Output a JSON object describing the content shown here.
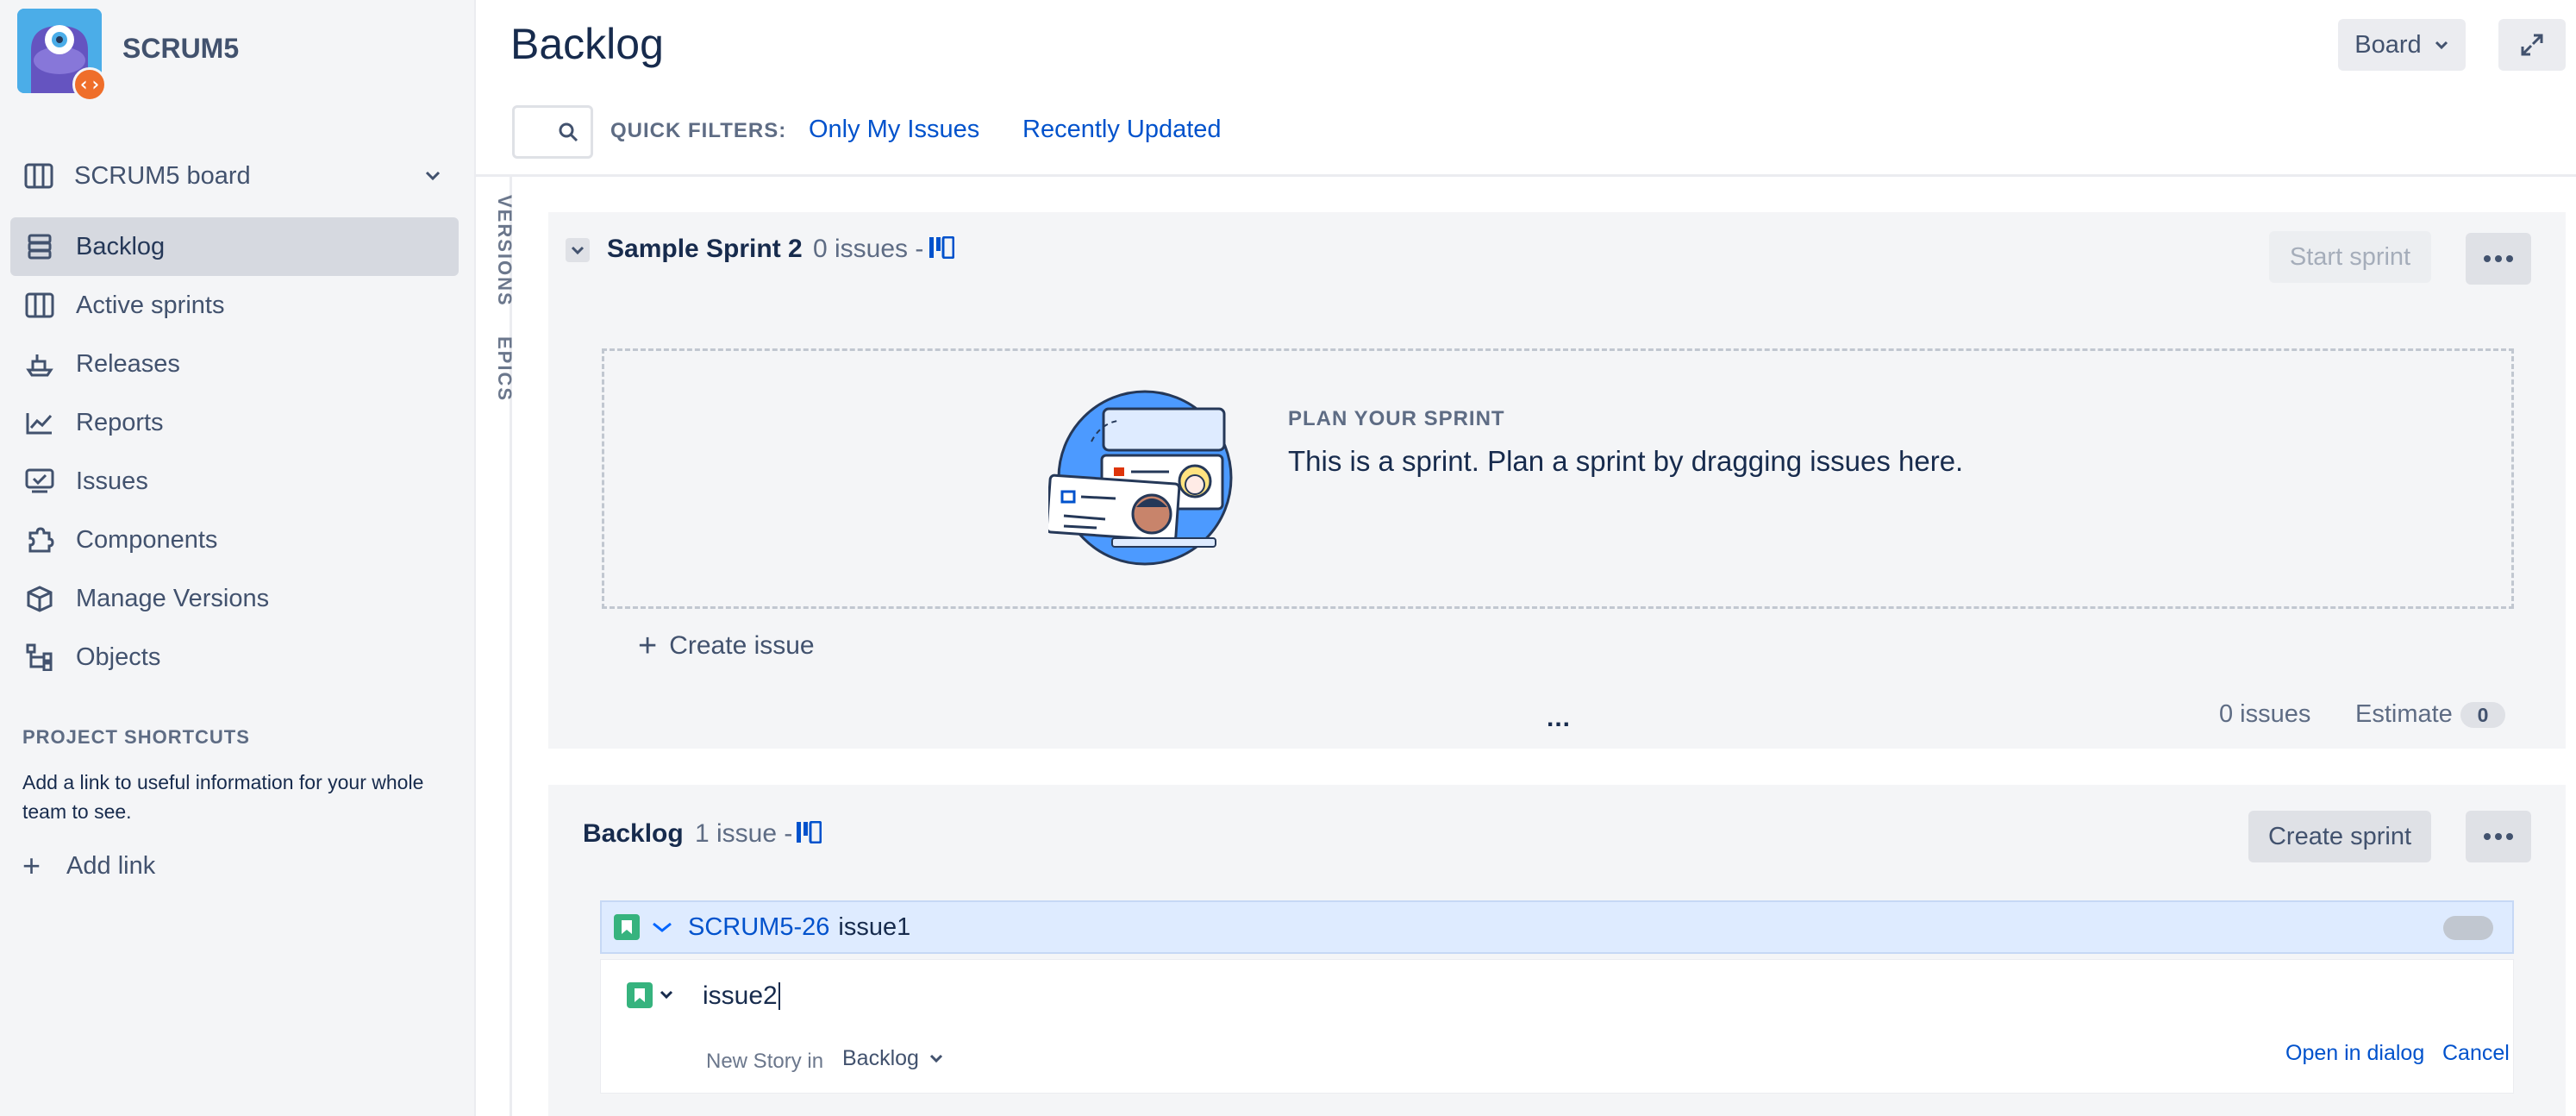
{
  "sidebar": {
    "project_name": "SCRUM5",
    "board_select_label": "SCRUM5 board",
    "nav": [
      {
        "label": "Backlog",
        "icon": "backlog-icon",
        "active": true
      },
      {
        "label": "Active sprints",
        "icon": "active-sprints-icon"
      },
      {
        "label": "Releases",
        "icon": "releases-icon"
      },
      {
        "label": "Reports",
        "icon": "reports-icon"
      },
      {
        "label": "Issues",
        "icon": "issues-icon"
      },
      {
        "label": "Components",
        "icon": "components-icon"
      },
      {
        "label": "Manage Versions",
        "icon": "versions-icon"
      },
      {
        "label": "Objects",
        "icon": "objects-icon"
      }
    ],
    "shortcuts_title": "PROJECT SHORTCUTS",
    "shortcuts_desc": "Add a link to useful information for your whole team to see.",
    "add_link_label": "Add link"
  },
  "rail": {
    "versions_label": "VERSIONS",
    "epics_label": "EPICS"
  },
  "header": {
    "title": "Backlog",
    "board_button_label": "Board",
    "quick_filters_label": "QUICK FILTERS:",
    "quick_filters": [
      "Only My Issues",
      "Recently Updated"
    ]
  },
  "sprint": {
    "name": "Sample Sprint 2",
    "issue_count": "0 issues -",
    "start_label": "Start sprint",
    "plan_title": "PLAN YOUR SPRINT",
    "plan_text": "This is a sprint. Plan a sprint by dragging issues here.",
    "create_issue_label": "Create issue",
    "ellipsis": "...",
    "footer_count": "0 issues",
    "estimate_label": "Estimate",
    "estimate_value": "0"
  },
  "backlog": {
    "name": "Backlog",
    "issue_count": "1 issue -",
    "create_sprint_label": "Create sprint",
    "issues": [
      {
        "key": "SCRUM5-26",
        "summary": "issue1",
        "type_icon": "story-icon",
        "priority_icon": "low-priority-icon"
      }
    ],
    "new_issue": {
      "summary_value": "issue2",
      "type_label": "New Story in",
      "destination": "Backlog",
      "open_dialog_label": "Open in dialog",
      "cancel_label": "Cancel"
    }
  },
  "colors": {
    "sidebar_bg": "#f4f5f7",
    "link": "#0052cc",
    "story_green": "#36b37e",
    "selected_row": "#deebff",
    "active_nav": "#d6d9e0"
  }
}
